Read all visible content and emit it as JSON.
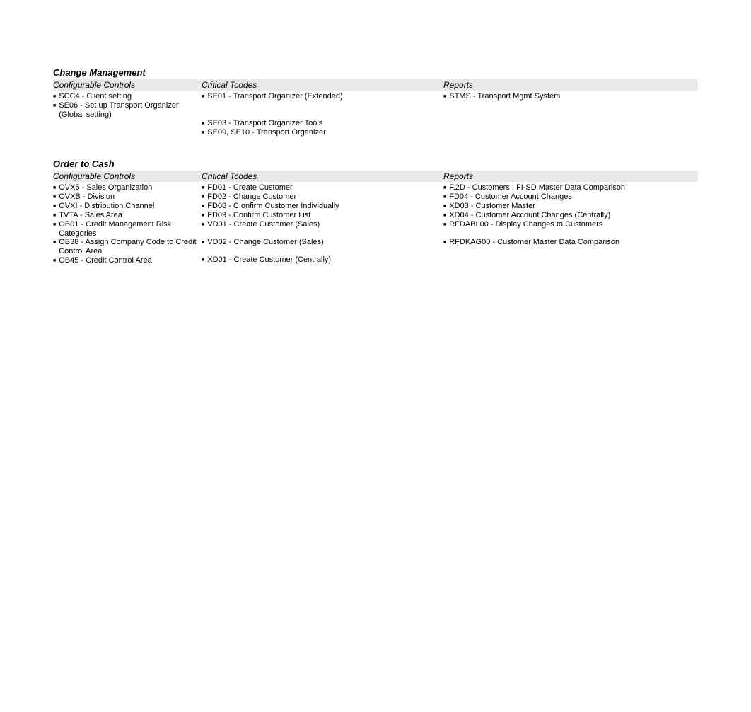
{
  "sections": [
    {
      "title": "Change Management",
      "col_headers": [
        "Configurable Controls",
        "Critical Tcodes",
        "Reports"
      ],
      "rows": [
        [
          {
            "v": "SCC4 - Client setting"
          },
          {
            "v": "SE01 - Transport Organizer (Extended)"
          },
          {
            "v": "STMS - Transport Mgmt System"
          }
        ],
        [
          {
            "v": "SE06 - Set up Transport Organizer (Global setting)",
            "tall": true
          },
          {
            "v": "",
            "tall": true,
            "empty": true
          },
          {
            "v": "",
            "tall": true,
            "empty": true
          }
        ],
        [
          {
            "v": "",
            "empty": true
          },
          {
            "v": "SE03 - Transport Organizer Tools"
          },
          {
            "v": "",
            "empty": true
          }
        ],
        [
          {
            "v": "",
            "empty": true
          },
          {
            "v": "SE09, SE10 - Transport Organizer"
          },
          {
            "v": "",
            "empty": true
          }
        ]
      ]
    },
    {
      "title": "Order to Cash",
      "col_headers": [
        "Configurable Controls",
        "Critical Tcodes",
        "Reports"
      ],
      "rows": [
        [
          {
            "v": "OVX5 - Sales Organization"
          },
          {
            "v": "FD01 - Create Customer"
          },
          {
            "v": "F.2D - Customers : FI-SD Master Data Comparison"
          }
        ],
        [
          {
            "v": "OVXB - Division"
          },
          {
            "v": "FD02 - Change Customer"
          },
          {
            "v": "FD04 - Customer Account Changes"
          }
        ],
        [
          {
            "v": "OVXI - Distribution Channel"
          },
          {
            "v": "FD08 - C onfirm Customer Individually"
          },
          {
            "v": "XD03 - Customer Master"
          }
        ],
        [
          {
            "v": "TVTA - Sales Area"
          },
          {
            "v": "FD09 - Confirm Customer List"
          },
          {
            "v": "XD04 - Customer Account Changes (Centrally)"
          }
        ],
        [
          {
            "v": "OB01 - Credit Management Risk Categories",
            "tall": true
          },
          {
            "v": "VD01 - Create Customer (Sales)",
            "tall": true
          },
          {
            "v": "RFDABL00 - Display Changes to Customers",
            "tall": true
          }
        ],
        [
          {
            "v": "OB38 - Assign Company Code to Credit Control Area",
            "tall": true
          },
          {
            "v": "VD02 - Change Customer (Sales)",
            "tall": true
          },
          {
            "v": "RFDKAG00 - Customer Master Data Comparison",
            "tall": true
          }
        ],
        [
          {
            "v": "OB45 - Credit Control Area"
          },
          {
            "v": "XD01 - Create Customer (Centrally)"
          },
          {
            "v": "",
            "empty": true
          }
        ]
      ]
    }
  ]
}
